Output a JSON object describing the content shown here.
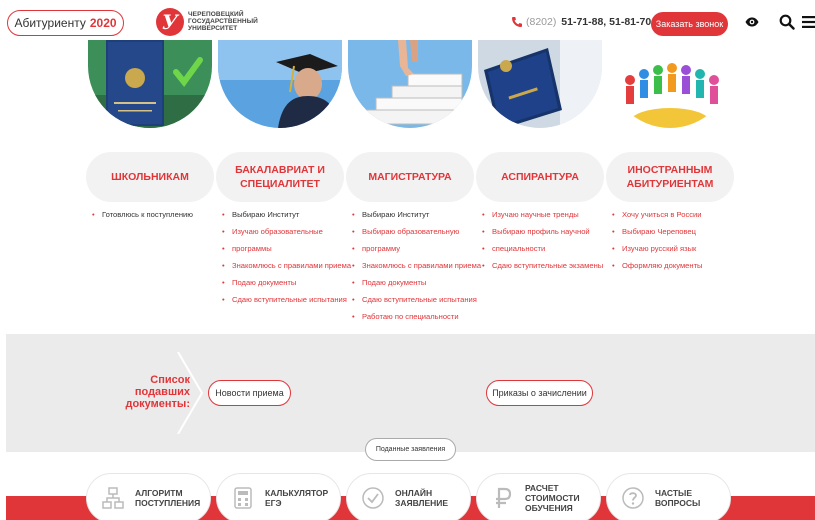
{
  "header": {
    "abit_label": "Абитуриенту",
    "abit_year": "2020",
    "logo_letter": "У",
    "logo_lines": [
      "Череповецкий",
      "государственный",
      "университет"
    ],
    "phone_code": "(8202)",
    "phone_numbers": "51-71-88, 51-81-70",
    "call_button": "Заказать звонок"
  },
  "categories": [
    {
      "title_line1": "Школьникам",
      "title_line2": "",
      "items": [
        {
          "text": "Готовлюсь к поступлению",
          "dark": true
        }
      ]
    },
    {
      "title_line1": "Бакалавриат и",
      "title_line2": "специалитет",
      "items": [
        {
          "text": "Выбираю Институт",
          "dark": true
        },
        {
          "text": "Изучаю образовательные",
          "dark": false
        },
        {
          "text": "программы",
          "dark": false
        },
        {
          "text": "Знакомлюсь с правилами приема",
          "dark": false
        },
        {
          "text": "Подаю документы",
          "dark": false
        },
        {
          "text": "Сдаю вступительные испытания",
          "dark": false
        }
      ]
    },
    {
      "title_line1": "Магистратура",
      "title_line2": "",
      "items": [
        {
          "text": "Выбираю Институт",
          "dark": true
        },
        {
          "text": "Выбираю образовательную",
          "dark": false
        },
        {
          "text": "программу",
          "dark": false
        },
        {
          "text": "Знакомлюсь с правилами приема",
          "dark": false
        },
        {
          "text": "Подаю документы",
          "dark": false
        },
        {
          "text": "Сдаю вступительные испытания",
          "dark": false
        },
        {
          "text": "Работаю по специальности",
          "dark": false
        }
      ]
    },
    {
      "title_line1": "Аспирантура",
      "title_line2": "",
      "items": [
        {
          "text": "Изучаю научные тренды",
          "dark": false
        },
        {
          "text": "Выбираю профиль научной",
          "dark": false
        },
        {
          "text": "специальности",
          "dark": false
        },
        {
          "text": "Сдаю вступительные экзамены",
          "dark": false
        }
      ]
    },
    {
      "title_line1": "Иностранным",
      "title_line2": "абитуриентам",
      "items": [
        {
          "text": "Хочу учиться в России",
          "dark": false
        },
        {
          "text": "Выбираю Череповец",
          "dark": false
        },
        {
          "text": "Изучаю русский язык",
          "dark": false
        },
        {
          "text": "Оформляю документы",
          "dark": false
        }
      ]
    }
  ],
  "docs": {
    "title_lines": [
      "Список",
      "подавших",
      "документы:"
    ],
    "news_button": "Новости приема",
    "orders_button": "Приказы о зачислении",
    "submitted_tab": "Поданные заявления"
  },
  "actions": [
    {
      "line1": "Алгоритм",
      "line2": "поступления",
      "line3": "",
      "icon": "flowchart-icon"
    },
    {
      "line1": "Калькулятор",
      "line2": "ЕГЭ",
      "line3": "",
      "icon": "calculator-icon"
    },
    {
      "line1": "Онлайн",
      "line2": "заявление",
      "line3": "",
      "icon": "check-circle-icon"
    },
    {
      "line1": "Расчет",
      "line2": "стоимости",
      "line3": "обучения",
      "icon": "ruble-icon"
    },
    {
      "line1": "Частые",
      "line2": "вопросы",
      "line3": "",
      "icon": "question-circle-icon"
    }
  ],
  "colors": {
    "accent": "#e0363a",
    "band": "#ebebeb",
    "pill": "#f2f2f2"
  }
}
